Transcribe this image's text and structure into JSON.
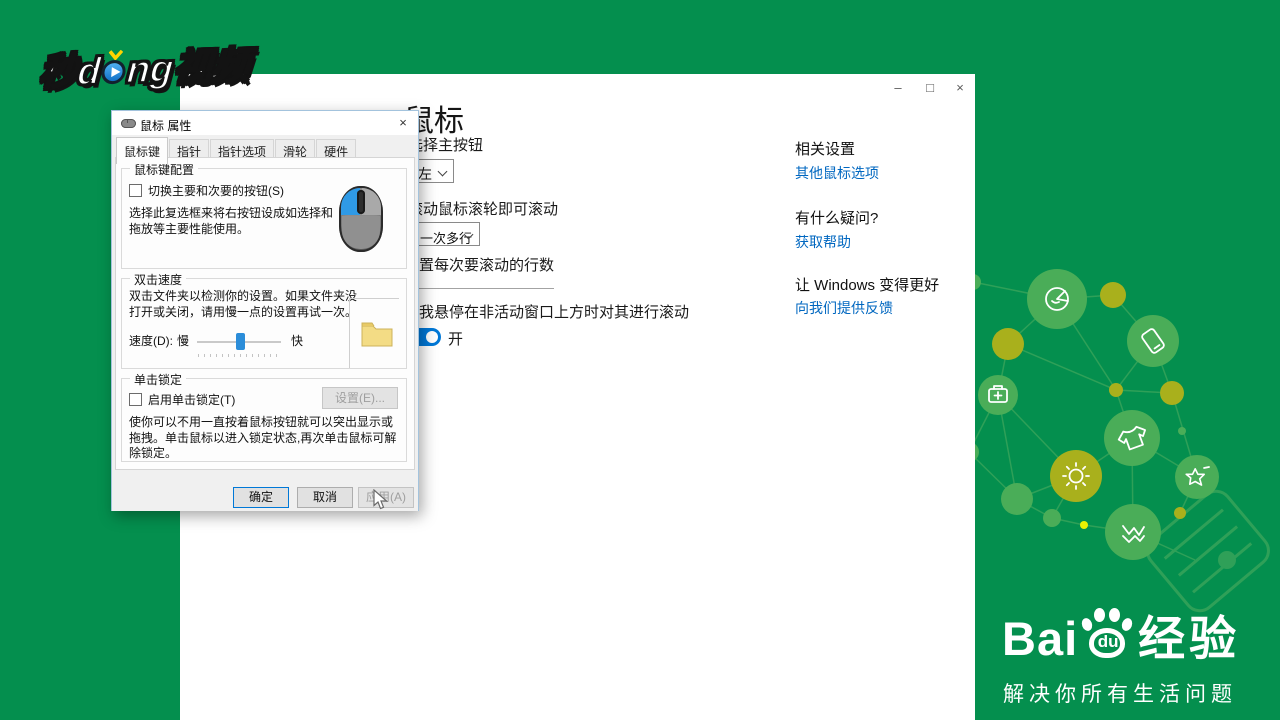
{
  "branding": {
    "video_logo": {
      "prefix": "秒d",
      "suffix": "ng视频"
    },
    "baidu": {
      "bai": "Bai",
      "du": "du",
      "jingyan": "经验",
      "tagline": "解决你所有生活问题"
    }
  },
  "settings": {
    "controls": {
      "minimize": "–",
      "maximize": "□",
      "close": "×"
    },
    "title": "鼠标",
    "primary_button_label": "选择主按钮",
    "primary_button_value": "左",
    "wheel_label": "滚动鼠标滚轮即可滚动",
    "wheel_value": "一次多行",
    "lines_label": "设置每次要滚动的行数",
    "hover_label": "当我悬停在非活动窗口上方时对其进行滚动",
    "toggle_state": "开",
    "related_heading": "相关设置",
    "related_link": "其他鼠标选项",
    "question_heading": "有什么疑问?",
    "question_link": "获取帮助",
    "better_heading": "让 Windows 变得更好",
    "better_link": "向我们提供反馈"
  },
  "dialog": {
    "title": "鼠标 属性",
    "close": "×",
    "tabs": [
      "鼠标键",
      "指针",
      "指针选项",
      "滑轮",
      "硬件"
    ],
    "g1": {
      "legend": "鼠标键配置",
      "checkbox": "切换主要和次要的按钮(S)",
      "desc": "选择此复选框来将右按钮设成如选择和拖放等主要性能使用。"
    },
    "g2": {
      "legend": "双击速度",
      "desc": "双击文件夹以检测你的设置。如果文件夹没打开或关闭，请用慢一点的设置再试一次。",
      "speed": "速度(D):",
      "slow": "慢",
      "fast": "快"
    },
    "g3": {
      "legend": "单击锁定",
      "checkbox": "启用单击锁定(T)",
      "button": "设置(E)...",
      "desc": "使你可以不用一直按着鼠标按钮就可以突出显示或拖拽。单击鼠标以进入锁定状态,再次单击鼠标可解除锁定。"
    },
    "buttons": {
      "ok": "确定",
      "cancel": "取消",
      "apply": "应用(A)"
    }
  },
  "colors": {
    "bg_green": "#048f4e",
    "accent_blue": "#0078d7",
    "link_blue": "#0067c0",
    "circle_green": "#4aad58",
    "circle_olive": "#a9b01c",
    "dot_yellow": "#e9f203"
  }
}
